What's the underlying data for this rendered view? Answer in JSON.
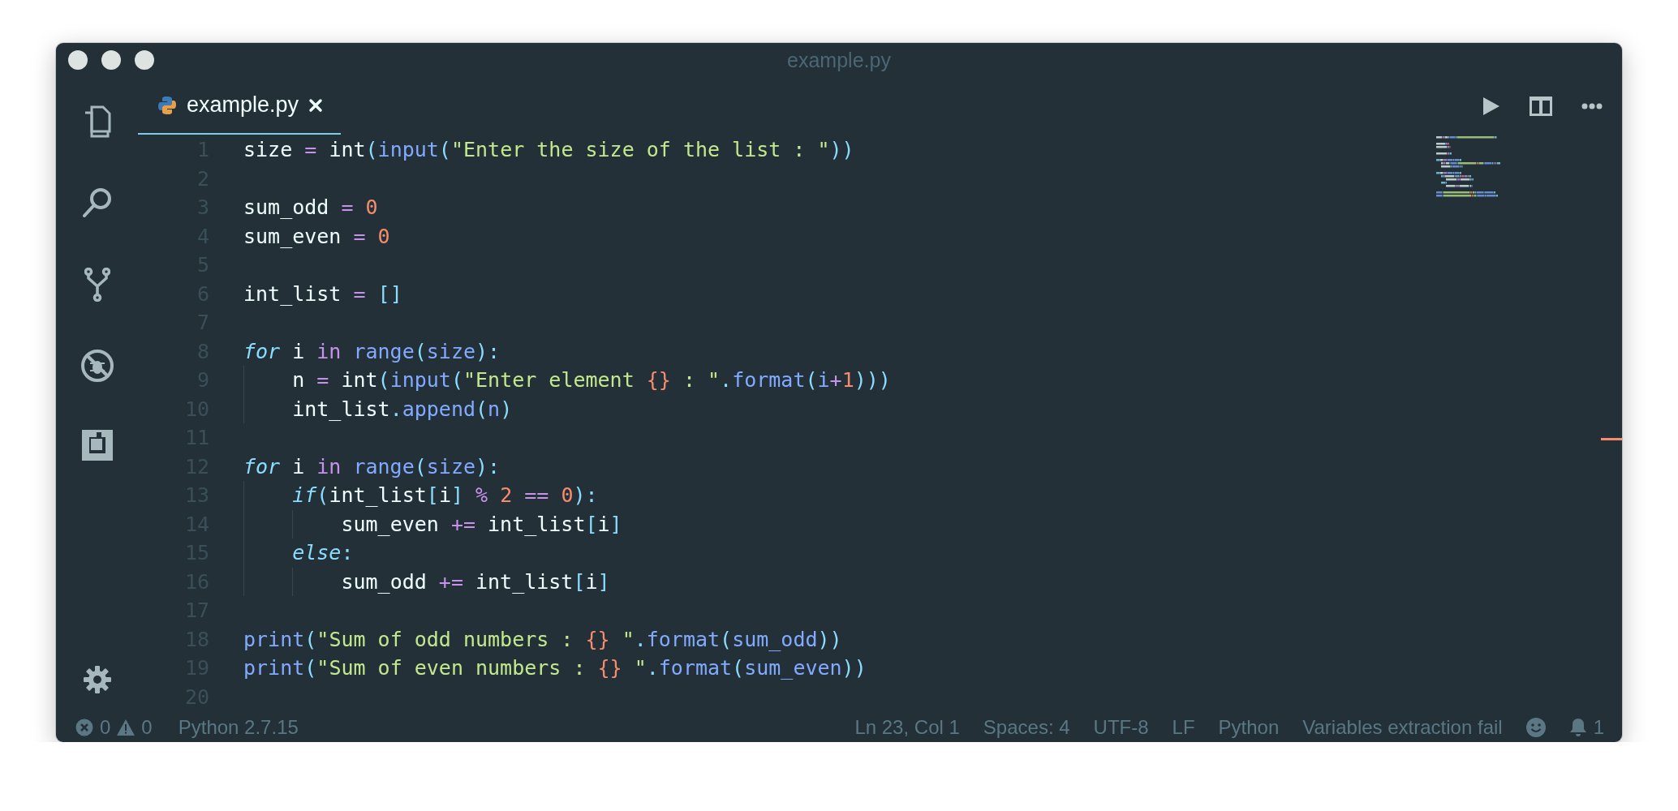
{
  "window": {
    "title": "example.py"
  },
  "tabs": [
    {
      "label": "example.py",
      "selected": true
    }
  ],
  "editor": {
    "lines": [
      {
        "number": "1",
        "tokens": [
          {
            "kind": "plain",
            "t": "size "
          },
          {
            "kind": "op",
            "t": "= "
          },
          {
            "kind": "plain",
            "t": "int"
          },
          {
            "kind": "punct",
            "t": "("
          },
          {
            "kind": "fn",
            "t": "input"
          },
          {
            "kind": "punct",
            "t": "("
          },
          {
            "kind": "str",
            "t": "\"Enter the size of the list : \""
          },
          {
            "kind": "punct",
            "t": "))"
          }
        ]
      },
      {
        "number": "2"
      },
      {
        "number": "3",
        "tokens": [
          {
            "kind": "plain",
            "t": "sum_odd "
          },
          {
            "kind": "op",
            "t": "= "
          },
          {
            "kind": "num",
            "t": "0"
          }
        ]
      },
      {
        "number": "4",
        "tokens": [
          {
            "kind": "plain",
            "t": "sum_even "
          },
          {
            "kind": "op",
            "t": "= "
          },
          {
            "kind": "num",
            "t": "0"
          }
        ]
      },
      {
        "number": "5"
      },
      {
        "number": "6",
        "tokens": [
          {
            "kind": "plain",
            "t": "int_list "
          },
          {
            "kind": "op",
            "t": "= "
          },
          {
            "kind": "punct",
            "t": "[]"
          }
        ]
      },
      {
        "number": "7"
      },
      {
        "number": "8",
        "tokens": [
          {
            "kind": "kw",
            "t": "for"
          },
          {
            "kind": "plain",
            "t": " i "
          },
          {
            "kind": "kw2",
            "t": "in "
          },
          {
            "kind": "fn",
            "t": "range"
          },
          {
            "kind": "punct",
            "t": "("
          },
          {
            "kind": "fn",
            "t": "size"
          },
          {
            "kind": "punct",
            "t": "):"
          }
        ]
      },
      {
        "number": "9",
        "tokens": [
          {
            "kind": "plain",
            "t": "    n "
          },
          {
            "kind": "op",
            "t": "= "
          },
          {
            "kind": "plain",
            "t": "int"
          },
          {
            "kind": "punct",
            "t": "("
          },
          {
            "kind": "fn",
            "t": "input"
          },
          {
            "kind": "punct",
            "t": "("
          },
          {
            "kind": "str",
            "t": "\"Enter element "
          },
          {
            "kind": "num",
            "t": "{}"
          },
          {
            "kind": "str",
            "t": " : \""
          },
          {
            "kind": "punct",
            "t": "."
          },
          {
            "kind": "fn",
            "t": "format"
          },
          {
            "kind": "punct",
            "t": "("
          },
          {
            "kind": "fn",
            "t": "i"
          },
          {
            "kind": "op",
            "t": "+"
          },
          {
            "kind": "num",
            "t": "1"
          },
          {
            "kind": "punct",
            "t": ")))"
          }
        ]
      },
      {
        "number": "10",
        "tokens": [
          {
            "kind": "plain",
            "t": "    int_list"
          },
          {
            "kind": "punct",
            "t": "."
          },
          {
            "kind": "fn",
            "t": "append"
          },
          {
            "kind": "punct",
            "t": "("
          },
          {
            "kind": "fn",
            "t": "n"
          },
          {
            "kind": "punct",
            "t": ")"
          }
        ]
      },
      {
        "number": "11"
      },
      {
        "number": "12",
        "tokens": [
          {
            "kind": "kw",
            "t": "for"
          },
          {
            "kind": "plain",
            "t": " i "
          },
          {
            "kind": "kw2",
            "t": "in "
          },
          {
            "kind": "fn",
            "t": "range"
          },
          {
            "kind": "punct",
            "t": "("
          },
          {
            "kind": "fn",
            "t": "size"
          },
          {
            "kind": "punct",
            "t": "):"
          }
        ]
      },
      {
        "number": "13",
        "tokens": [
          {
            "kind": "kw",
            "t": "    if"
          },
          {
            "kind": "punct",
            "t": "("
          },
          {
            "kind": "plain",
            "t": "int_list"
          },
          {
            "kind": "punct",
            "t": "["
          },
          {
            "kind": "plain",
            "t": "i"
          },
          {
            "kind": "punct",
            "t": "] "
          },
          {
            "kind": "op",
            "t": "% "
          },
          {
            "kind": "num",
            "t": "2 "
          },
          {
            "kind": "op",
            "t": "== "
          },
          {
            "kind": "num",
            "t": "0"
          },
          {
            "kind": "punct",
            "t": "):"
          }
        ]
      },
      {
        "number": "14",
        "tokens": [
          {
            "kind": "plain",
            "t": "        sum_even "
          },
          {
            "kind": "op",
            "t": "+= "
          },
          {
            "kind": "plain",
            "t": "int_list"
          },
          {
            "kind": "punct",
            "t": "["
          },
          {
            "kind": "plain",
            "t": "i"
          },
          {
            "kind": "punct",
            "t": "]"
          }
        ]
      },
      {
        "number": "15",
        "tokens": [
          {
            "kind": "kw",
            "t": "    else"
          },
          {
            "kind": "punct",
            "t": ":"
          }
        ]
      },
      {
        "number": "16",
        "tokens": [
          {
            "kind": "plain",
            "t": "        sum_odd "
          },
          {
            "kind": "op",
            "t": "+= "
          },
          {
            "kind": "plain",
            "t": "int_list"
          },
          {
            "kind": "punct",
            "t": "["
          },
          {
            "kind": "plain",
            "t": "i"
          },
          {
            "kind": "punct",
            "t": "]"
          }
        ]
      },
      {
        "number": "17"
      },
      {
        "number": "18",
        "tokens": [
          {
            "kind": "fn",
            "t": "print"
          },
          {
            "kind": "punct",
            "t": "("
          },
          {
            "kind": "str",
            "t": "\"Sum of odd numbers : "
          },
          {
            "kind": "num",
            "t": "{}"
          },
          {
            "kind": "str",
            "t": " \""
          },
          {
            "kind": "punct",
            "t": "."
          },
          {
            "kind": "fn",
            "t": "format"
          },
          {
            "kind": "punct",
            "t": "("
          },
          {
            "kind": "fn",
            "t": "sum_odd"
          },
          {
            "kind": "punct",
            "t": "))"
          }
        ]
      },
      {
        "number": "19",
        "tokens": [
          {
            "kind": "fn",
            "t": "print"
          },
          {
            "kind": "punct",
            "t": "("
          },
          {
            "kind": "str",
            "t": "\"Sum of even numbers : "
          },
          {
            "kind": "num",
            "t": "{}"
          },
          {
            "kind": "str",
            "t": " \""
          },
          {
            "kind": "punct",
            "t": "."
          },
          {
            "kind": "fn",
            "t": "format"
          },
          {
            "kind": "punct",
            "t": "("
          },
          {
            "kind": "fn",
            "t": "sum_even"
          },
          {
            "kind": "punct",
            "t": "))"
          }
        ]
      },
      {
        "number": "20"
      }
    ]
  },
  "status_bar": {
    "errors": "0",
    "warnings": "0",
    "interpreter": "Python 2.7.15",
    "right_items": [
      "Ln 23, Col 1",
      "Spaces: 4",
      "UTF-8",
      "LF",
      "Python",
      "Variables extraction fail"
    ],
    "notifications": "1"
  }
}
